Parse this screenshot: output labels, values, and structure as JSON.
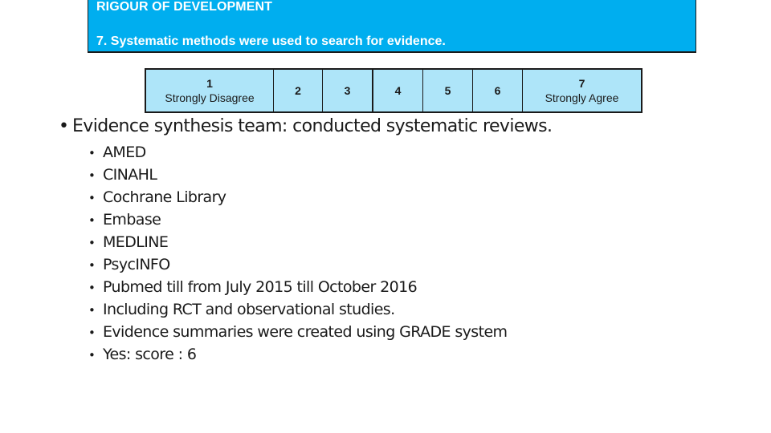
{
  "header": {
    "title": "RIGOUR OF DEVELOPMENT",
    "question": "7. Systematic methods were used to search for evidence.",
    "background_color": "#00aeef"
  },
  "scale": {
    "background_color": "#aee5f9",
    "options": [
      {
        "value": "1",
        "label": "Strongly Disagree"
      },
      {
        "value": "2",
        "label": ""
      },
      {
        "value": "3",
        "label": ""
      },
      {
        "value": "4",
        "label": ""
      },
      {
        "value": "5",
        "label": ""
      },
      {
        "value": "6",
        "label": ""
      },
      {
        "value": "7",
        "label": "Strongly Agree"
      }
    ]
  },
  "content": {
    "bullet_glyph": "•",
    "main_point": "Evidence synthesis team: conducted systematic reviews.",
    "sub_points": [
      "AMED",
      "CINAHL",
      "Cochrane Library",
      "Embase",
      "MEDLINE",
      "PsycINFO",
      "Pubmed till from July 2015 till October 2016",
      "Including RCT and observational studies.",
      "Evidence summaries were created using GRADE system",
      "Yes: score : 6"
    ]
  }
}
